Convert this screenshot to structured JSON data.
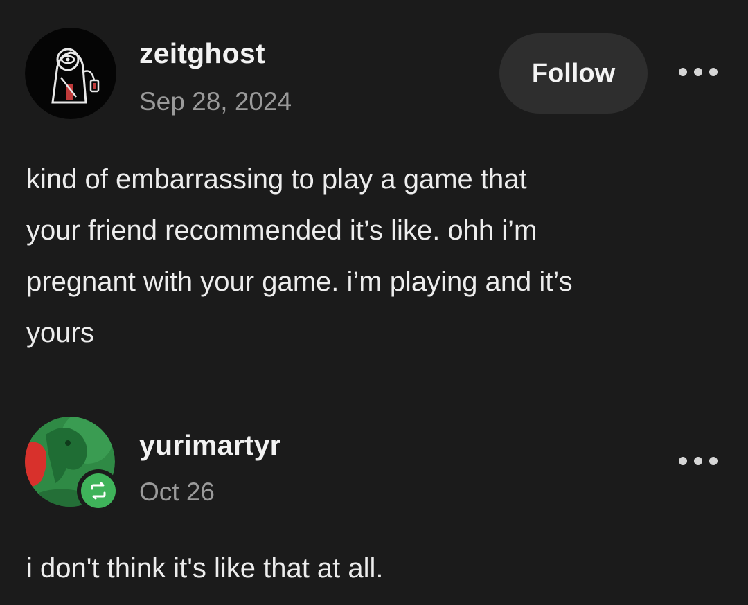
{
  "original_post": {
    "avatar_icon": "lantern-figure-avatar-icon",
    "username": "zeitghost",
    "date": "Sep 28, 2024",
    "follow_label": "Follow",
    "more_icon": "more-options-icon",
    "body_lines": [
      "kind of embarrassing to play a game that",
      "your friend recommended it’s like. ohh i’m",
      "pregnant with your game. i’m playing and it’s",
      "yours"
    ]
  },
  "reblog": {
    "avatar_icon": "green-creature-avatar-icon",
    "badge_icon": "reblog-icon",
    "username": "yurimartyr",
    "date": "Oct 26",
    "more_icon": "more-options-icon",
    "body": "i don't think it's like that at all."
  },
  "colors": {
    "background": "#1b1b1b",
    "follow_button": "#2e2e2e",
    "reblog_badge": "#3fb35a",
    "muted_text": "#9a9a9a"
  }
}
